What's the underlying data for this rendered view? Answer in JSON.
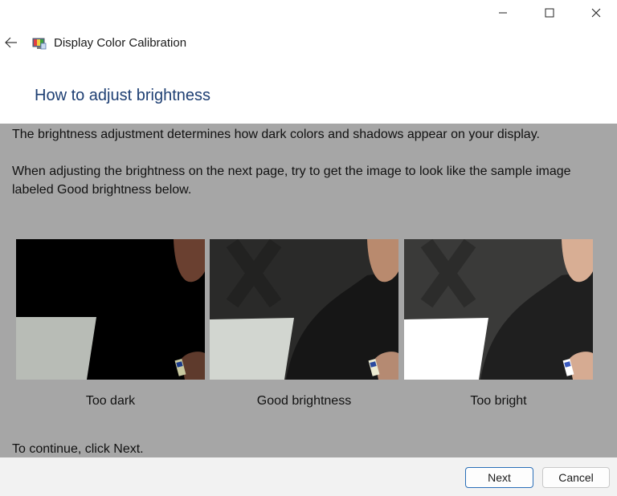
{
  "window": {
    "title": "Display Color Calibration",
    "app_icon": "display-color-calibration-icon",
    "controls": [
      "minimize-icon",
      "maximize-icon",
      "close-icon"
    ]
  },
  "nav": {
    "back_icon": "back-arrow-icon"
  },
  "page": {
    "heading": "How to adjust brightness",
    "paragraph1": "The brightness adjustment determines how dark colors and shadows appear on your display.",
    "paragraph2": "When adjusting the brightness on the next page, try to get the image to look like the sample image labeled Good brightness below.",
    "samples": [
      {
        "label": "Too dark"
      },
      {
        "label": "Good brightness"
      },
      {
        "label": "Too bright"
      }
    ],
    "continue_text": "To continue, click Next."
  },
  "footer": {
    "next_label": "Next",
    "cancel_label": "Cancel"
  },
  "colors": {
    "heading": "#1e3f73",
    "panel": "#a6a6a6",
    "footer": "#f2f2f2",
    "next_border": "#2a6fb8"
  }
}
